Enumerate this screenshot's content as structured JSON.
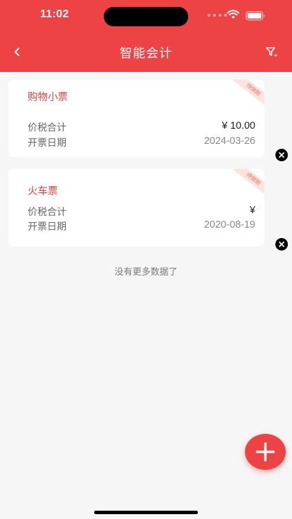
{
  "status_bar": {
    "time": "11:02"
  },
  "nav": {
    "title": "智能会计",
    "back_icon": "chevron-left-icon",
    "filter_icon": "filter-icon"
  },
  "invoices": [
    {
      "title": "购物小票",
      "badge": "待做账",
      "tax_label": "价税合计",
      "amount": "¥ 10.00",
      "date_label": "开票日期",
      "date": "2024-03-26"
    },
    {
      "title": "火车票",
      "badge": "待做账",
      "tax_label": "价税合计",
      "amount": "¥",
      "date_label": "开票日期",
      "date": "2020-08-19"
    }
  ],
  "list_footer": "没有更多数据了",
  "colors": {
    "primary": "#ee4344",
    "background": "#f6f6f6",
    "card": "#ffffff",
    "title_red": "#e2403f"
  }
}
